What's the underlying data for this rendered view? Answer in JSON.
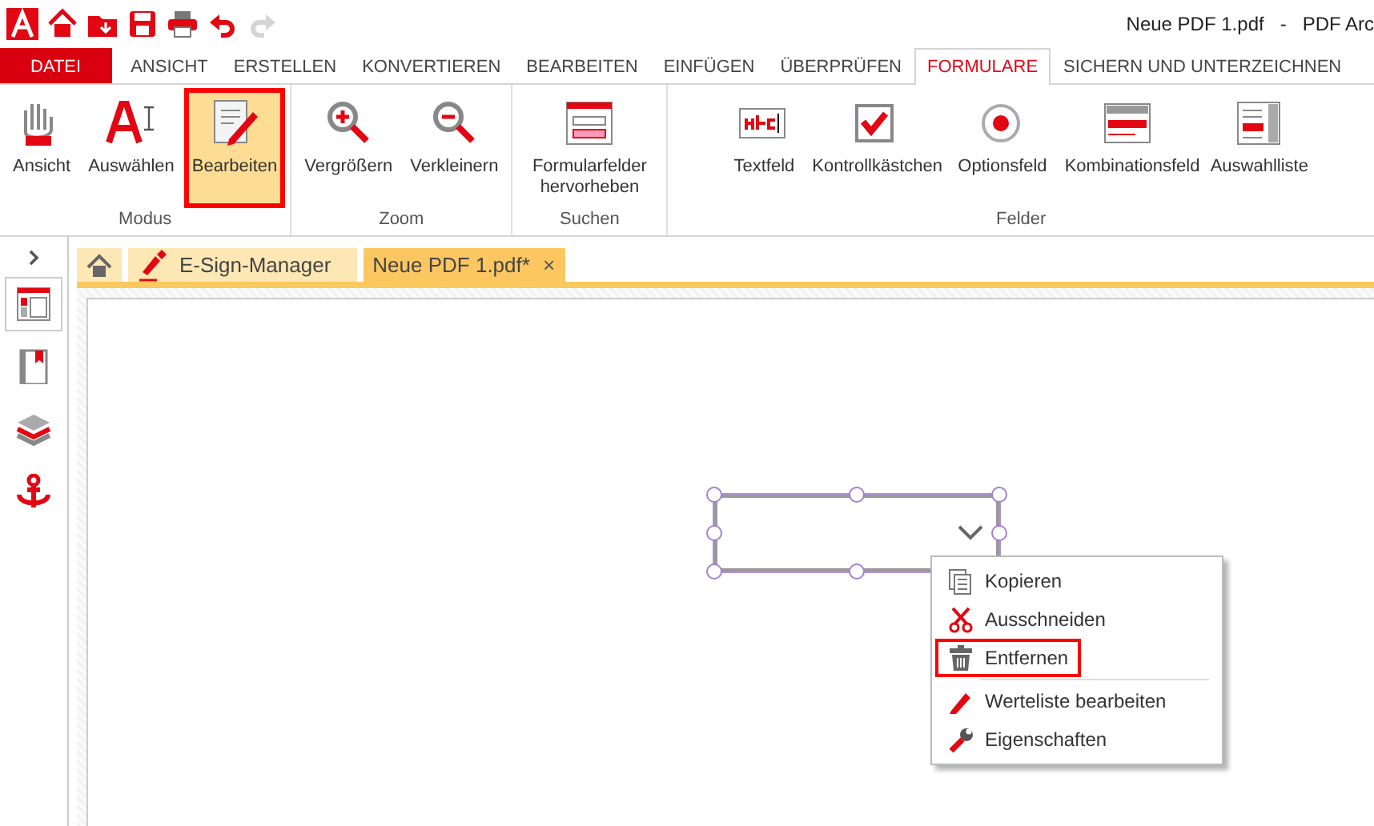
{
  "window": {
    "title": "Neue PDF 1.pdf   -   PDF Arc"
  },
  "quick_access": [
    {
      "kind": "logo",
      "disabled": false
    },
    {
      "kind": "home",
      "disabled": false
    },
    {
      "kind": "folder",
      "disabled": false
    },
    {
      "kind": "save",
      "disabled": false
    },
    {
      "kind": "print",
      "disabled": false
    },
    {
      "kind": "undo",
      "disabled": false
    },
    {
      "kind": "redo",
      "disabled": true
    }
  ],
  "menu_tabs": [
    {
      "label": "DATEI",
      "kind": "file",
      "selected": false
    },
    {
      "label": "ANSICHT",
      "kind": "tab",
      "selected": false
    },
    {
      "label": "ERSTELLEN",
      "kind": "tab",
      "selected": false
    },
    {
      "label": "KONVERTIEREN",
      "kind": "tab",
      "selected": false
    },
    {
      "label": "BEARBEITEN",
      "kind": "tab",
      "selected": false
    },
    {
      "label": "EINFÜGEN",
      "kind": "tab",
      "selected": false
    },
    {
      "label": "ÜBERPRÜFEN",
      "kind": "tab",
      "selected": false
    },
    {
      "label": "FORMULARE",
      "kind": "tab",
      "selected": true
    },
    {
      "label": "SICHERN UND UNTERZEICHNEN",
      "kind": "tab",
      "selected": false
    }
  ],
  "ribbon_groups": [
    {
      "label": "Modus",
      "buttons": [
        {
          "label": "Ansicht",
          "kind": "hand",
          "selected": false
        },
        {
          "label": "Auswählen",
          "kind": "select",
          "selected": false
        },
        {
          "label": "Bearbeiten",
          "kind": "edit",
          "selected": true
        }
      ]
    },
    {
      "label": "Zoom",
      "buttons": [
        {
          "label": "Vergrößern",
          "kind": "zoomin",
          "selected": false
        },
        {
          "label": "Verkleinern",
          "kind": "zoomout",
          "selected": false
        }
      ]
    },
    {
      "label": "Suchen",
      "buttons": [
        {
          "label": "Formularfelder hervorheben",
          "kind": "highlight",
          "selected": false
        }
      ]
    },
    {
      "label": "Felder",
      "buttons": [
        {
          "label": "Textfeld",
          "kind": "textfield",
          "selected": false
        },
        {
          "label": "Kontrollkästchen",
          "kind": "checkbox",
          "selected": false
        },
        {
          "label": "Optionsfeld",
          "kind": "radio",
          "selected": false
        },
        {
          "label": "Kombinationsfeld",
          "kind": "combo",
          "selected": false
        },
        {
          "label": "Auswahlliste",
          "kind": "list",
          "selected": false
        }
      ]
    }
  ],
  "sidebar": {
    "items": [
      {
        "kind": "pages",
        "selected": true
      },
      {
        "kind": "bookmark",
        "selected": false
      },
      {
        "kind": "layers",
        "selected": false
      },
      {
        "kind": "anchor",
        "selected": false
      }
    ]
  },
  "doc_tabs": [
    {
      "kind": "home",
      "selected": false
    },
    {
      "kind": "esign",
      "label": "E-Sign-Manager",
      "selected": false
    },
    {
      "kind": "doc",
      "label": "Neue PDF 1.pdf*",
      "close": "×",
      "selected": true
    }
  ],
  "context_menu": {
    "items": [
      {
        "label": "Kopieren",
        "kind": "copy",
        "highlighted": false,
        "separator_after": false
      },
      {
        "label": "Ausschneiden",
        "kind": "cut",
        "highlighted": false,
        "separator_after": false
      },
      {
        "label": "Entfernen",
        "kind": "trash",
        "highlighted": true,
        "separator_after": true
      },
      {
        "label": "Werteliste bearbeiten",
        "kind": "pencil",
        "highlighted": false,
        "separator_after": false
      },
      {
        "label": "Eigenschaften",
        "kind": "wrench",
        "highlighted": false,
        "separator_after": false
      }
    ]
  }
}
